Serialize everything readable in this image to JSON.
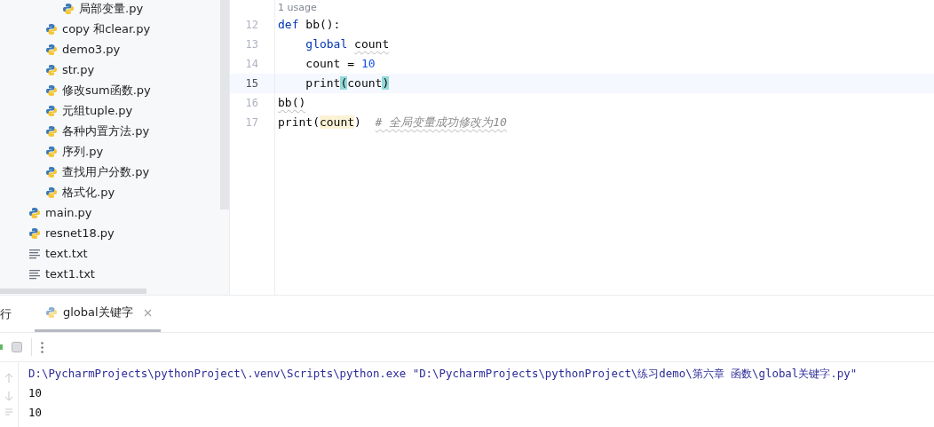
{
  "project_tree": [
    {
      "children": [
        {
          "children": [
            {
              "label": "局部变量.py",
              "kind": "python"
            }
          ]
        },
        {
          "label": "copy 和clear.py",
          "kind": "python"
        },
        {
          "label": "demo3.py",
          "kind": "python"
        },
        {
          "label": "str.py",
          "kind": "python"
        },
        {
          "label": "修改sum函数.py",
          "kind": "python"
        },
        {
          "label": "元组tuple.py",
          "kind": "python"
        },
        {
          "label": "各种内置方法.py",
          "kind": "python"
        },
        {
          "label": "序列.py",
          "kind": "python"
        },
        {
          "label": "查找用户分数.py",
          "kind": "python"
        },
        {
          "label": "格式化.py",
          "kind": "python"
        }
      ]
    },
    {
      "label": "main.py",
      "kind": "python"
    },
    {
      "label": "resnet18.py",
      "kind": "python"
    },
    {
      "label": "text.txt",
      "kind": "text"
    },
    {
      "label": "text1.txt",
      "kind": "text"
    }
  ],
  "editor": {
    "usage_hint": "1 usage",
    "lines": [
      {
        "number": "12",
        "current": false,
        "tokens": [
          {
            "text": "def",
            "kind": "keyword"
          },
          {
            "text": " bb():",
            "kind": "plain"
          }
        ]
      },
      {
        "number": "13",
        "current": false,
        "tokens": [
          {
            "text": "    global ",
            "kind": "keyword"
          },
          {
            "text": "count",
            "kind": "warn"
          }
        ]
      },
      {
        "number": "14",
        "current": false,
        "tokens": [
          {
            "text": "    count = ",
            "kind": "plain"
          },
          {
            "text": "10",
            "kind": "number"
          }
        ]
      },
      {
        "number": "15",
        "current": true,
        "tokens": [
          {
            "text": "    print",
            "kind": "plain"
          },
          {
            "text": "(",
            "kind": "brace"
          },
          {
            "text": "count",
            "kind": "plain"
          },
          {
            "text": ")",
            "kind": "brace"
          }
        ]
      },
      {
        "number": "16",
        "current": false,
        "tokens": [
          {
            "text": "bb()",
            "kind": "warn"
          }
        ]
      },
      {
        "number": "17",
        "current": false,
        "tokens": [
          {
            "text": "print(",
            "kind": "plain"
          },
          {
            "text": "count",
            "kind": "usage"
          },
          {
            "text": ")  ",
            "kind": "plain"
          },
          {
            "text": "# 全局变量成功修改为10",
            "kind": "comment"
          }
        ]
      }
    ]
  },
  "run_panel": {
    "title": "行",
    "tabs": [
      {
        "label": "global关键字",
        "selected": true
      }
    ],
    "console": [
      {
        "text": "D:\\PycharmProjects\\pythonProject\\.venv\\Scripts\\python.exe \"D:\\PycharmProjects\\pythonProject\\练习demo\\第六章 函数\\global关键字.py\"",
        "kind": "command"
      },
      {
        "text": "10",
        "kind": "output"
      },
      {
        "text": "10",
        "kind": "output"
      }
    ]
  }
}
